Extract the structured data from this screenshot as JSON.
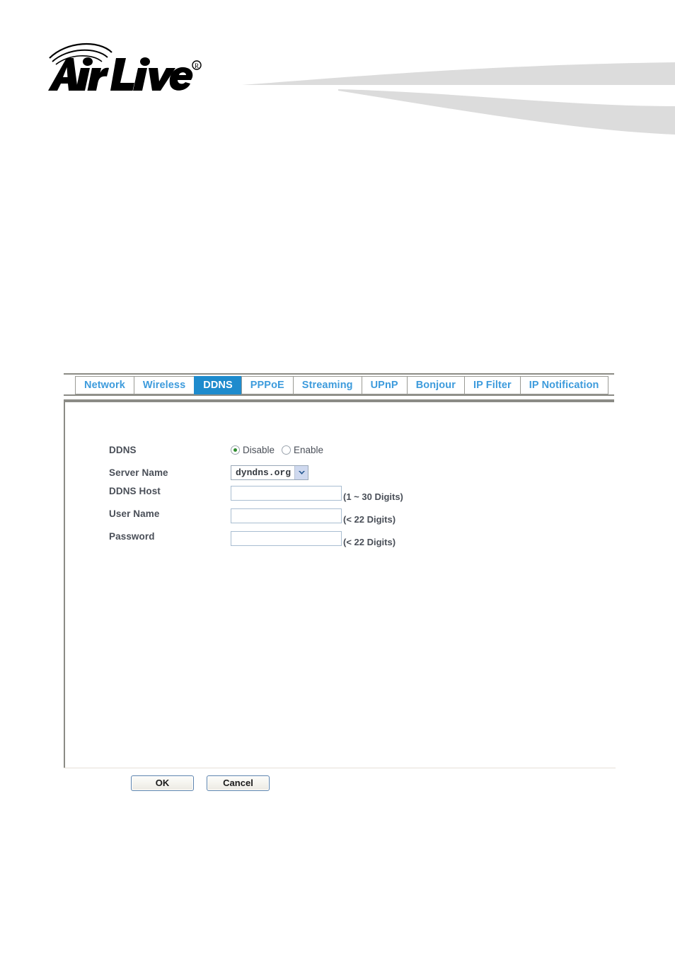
{
  "brand": {
    "logo_text": "Air Live",
    "logo_trademark": "®"
  },
  "tabs": [
    {
      "label": "Network",
      "active": false
    },
    {
      "label": "Wireless",
      "active": false
    },
    {
      "label": "DDNS",
      "active": true
    },
    {
      "label": "PPPoE",
      "active": false
    },
    {
      "label": "Streaming",
      "active": false
    },
    {
      "label": "UPnP",
      "active": false
    },
    {
      "label": "Bonjour",
      "active": false
    },
    {
      "label": "IP Filter",
      "active": false
    },
    {
      "label": "IP Notification",
      "active": false
    }
  ],
  "form": {
    "ddns": {
      "label": "DDNS",
      "options": [
        {
          "label": "Disable",
          "checked": true
        },
        {
          "label": "Enable",
          "checked": false
        }
      ]
    },
    "server_name": {
      "label": "Server Name",
      "value": "dyndns.org"
    },
    "ddns_host": {
      "label": "DDNS Host",
      "value": "",
      "placeholder": "",
      "hint": "(1 ~ 30 Digits)"
    },
    "user_name": {
      "label": "User Name",
      "value": "",
      "placeholder": "",
      "hint": "(< 22 Digits)"
    },
    "password": {
      "label": "Password",
      "value": "",
      "placeholder": "",
      "hint": "(< 22 Digits)"
    }
  },
  "footer": {
    "ok_label": "OK",
    "cancel_label": "Cancel"
  },
  "colors": {
    "tab_text": "#3d9bdc",
    "tab_active_bg": "#1e8bcd",
    "label_text": "#4a4f58",
    "rule": "#8b8b85",
    "swoosh": "#dcdcdc",
    "radio_dot": "#2f8c2f"
  }
}
